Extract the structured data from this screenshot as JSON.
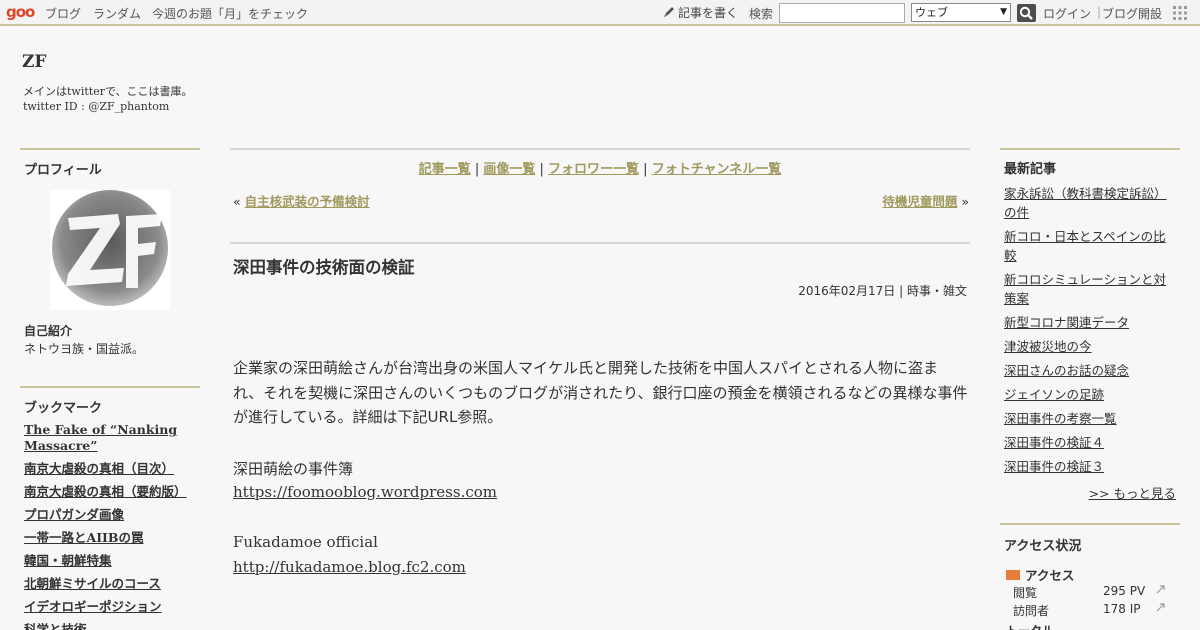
{
  "topbar": {
    "logo": "goo",
    "links": [
      "ブログ",
      "ランダム",
      "今週のお題「月」をチェック"
    ],
    "write": "記事を書く",
    "search_label": "検索",
    "search_value": "",
    "search_scope": "ウェブ",
    "login": "ログイン",
    "separator": "|",
    "blog_start": "ブログ開設"
  },
  "blog": {
    "title": "ZF",
    "desc_line1": "メインはtwitterで、ここは書庫。",
    "desc_line2": "twitter ID : @ZF_phantom"
  },
  "profile": {
    "heading": "プロフィール",
    "intro_heading": "自己紹介",
    "intro_text": "ネトウヨ族・国益派。"
  },
  "bookmarks": {
    "heading": "ブックマーク",
    "items": [
      "The Fake of “Nanking Massacre”",
      "南京大虐殺の真相（目次）",
      "南京大虐殺の真相（要約版）",
      "プロパガンダ画像",
      "一帯一路とAIIBの罠",
      "韓国・朝鮮特集",
      "北朝鮮ミサイルのコース",
      "イデオロギーポジション",
      "科学と技術"
    ]
  },
  "center": {
    "links": [
      "記事一覧",
      "画像一覧",
      "フォロワー一覧",
      "フォトチャンネル一覧"
    ],
    "link_sep": " | ",
    "prev_prefix": "« ",
    "prev_label": "自主核武装の予備検討",
    "next_label": "待機児童問題",
    "next_suffix": " »"
  },
  "post": {
    "title": "深田事件の技術面の検証",
    "date": "2016年02月17日",
    "meta_sep": " | ",
    "category": "時事・雑文",
    "body": "企業家の深田萌絵さんが台湾出身の米国人マイケル氏と開発した技術を中国人スパイとされる人物に盗まれ、それを契機に深田さんのいくつものブログが消されたり、銀行口座の預金を横領されるなどの異様な事件が進行している。詳細は下記URL参照。",
    "line1": "深田萌絵の事件簿",
    "url1": "https://foomooblog.wordpress.com",
    "line2": "Fukadamoe official",
    "url2": "http://fukadamoe.blog.fc2.com"
  },
  "recent": {
    "heading": "最新記事",
    "items": [
      "家永訴訟（教科書検定訴訟）の件",
      "新コロ・日本とスペインの比較",
      "新コロシミュレーションと対策案",
      "新型コロナ関連データ",
      "津波被災地の今",
      "深田さんのお話の疑念",
      "ジェイソンの足跡",
      "深田事件の考察一覧",
      "深田事件の検証４",
      "深田事件の検証３"
    ],
    "more": ">> もっと見る"
  },
  "access": {
    "heading": "アクセス状況",
    "title": "アクセス",
    "rows": [
      {
        "label": "閲覧",
        "value": "295 PV"
      },
      {
        "label": "訪問者",
        "value": "178 IP"
      }
    ],
    "next_title": "トータル"
  },
  "colors": {
    "accent_rule": "#c9c39c",
    "link_olive": "#a09a5f",
    "logo_red": "#e0452a"
  }
}
